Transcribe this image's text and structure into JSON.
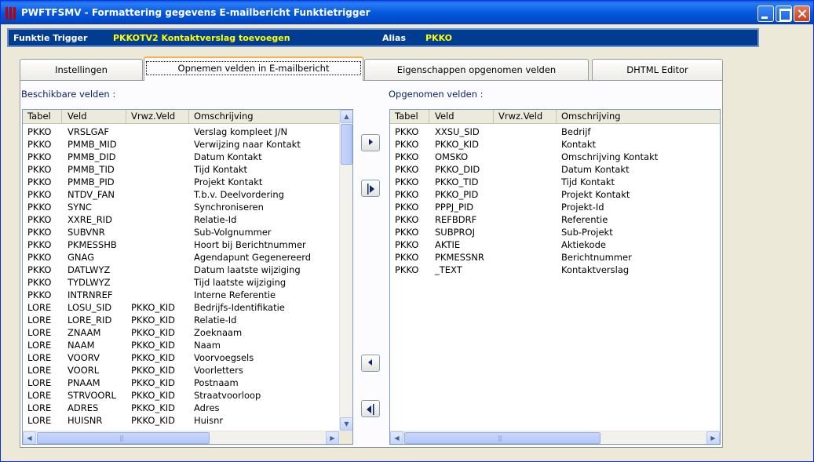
{
  "window": {
    "title": "PWFTFSMV - Formattering gegevens E-mailbericht Funktietrigger"
  },
  "infobar": {
    "function_label": "Funktie Trigger",
    "function_value": "PKKOTV2  Kontaktverslag toevoegen",
    "alias_label": "Alias",
    "alias_value": "PKKO"
  },
  "tabs": [
    {
      "label": "Instellingen"
    },
    {
      "label": "Opnemen velden in E-mailbericht"
    },
    {
      "label": "Eigenschappen opgenomen velden"
    },
    {
      "label": "DHTML Editor"
    }
  ],
  "available": {
    "title": "Beschikbare velden :",
    "columns": [
      "Tabel",
      "Veld",
      "Vrwz.Veld",
      "Omschrijving"
    ],
    "rows": [
      [
        "PKKO",
        "VRSLGAF",
        "",
        "Verslag kompleet J/N"
      ],
      [
        "PKKO",
        "PMMB_MID",
        "",
        "Verwijzing naar Kontakt"
      ],
      [
        "PKKO",
        "PMMB_DID",
        "",
        "Datum Kontakt"
      ],
      [
        "PKKO",
        "PMMB_TID",
        "",
        "Tijd Kontakt"
      ],
      [
        "PKKO",
        "PMMB_PID",
        "",
        "Projekt Kontakt"
      ],
      [
        "PKKO",
        "NTDV_FAN",
        "",
        "T.b.v. Deelvordering"
      ],
      [
        "PKKO",
        "SYNC",
        "",
        "Synchroniseren"
      ],
      [
        "PKKO",
        "XXRE_RID",
        "",
        "Relatie-Id"
      ],
      [
        "PKKO",
        "SUBVNR",
        "",
        "Sub-Volgnummer"
      ],
      [
        "PKKO",
        "PKMESSHB",
        "",
        "Hoort bij Berichtnummer"
      ],
      [
        "PKKO",
        "GNAG",
        "",
        "Agendapunt Gegenereerd"
      ],
      [
        "PKKO",
        "DATLWYZ",
        "",
        "Datum laatste wijziging"
      ],
      [
        "PKKO",
        "TYDLWYZ",
        "",
        "Tijd laatste wijziging"
      ],
      [
        "PKKO",
        "INTRNREF",
        "",
        "Interne Referentie"
      ],
      [
        "LORE",
        "LOSU_SID",
        "PKKO_KID",
        "Bedrijfs-Identifikatie"
      ],
      [
        "LORE",
        "LORE_RID",
        "PKKO_KID",
        "Relatie-Id"
      ],
      [
        "LORE",
        "ZNAAM",
        "PKKO_KID",
        "Zoeknaam"
      ],
      [
        "LORE",
        "NAAM",
        "PKKO_KID",
        "Naam"
      ],
      [
        "LORE",
        "VOORV",
        "PKKO_KID",
        "Voorvoegsels"
      ],
      [
        "LORE",
        "VOORL",
        "PKKO_KID",
        "Voorletters"
      ],
      [
        "LORE",
        "PNAAM",
        "PKKO_KID",
        "Postnaam"
      ],
      [
        "LORE",
        "STRVOORL",
        "PKKO_KID",
        "Straatvoorloop"
      ],
      [
        "LORE",
        "ADRES",
        "PKKO_KID",
        "Adres"
      ],
      [
        "LORE",
        "HUISNR",
        "PKKO_KID",
        "Huisnr"
      ]
    ]
  },
  "selected": {
    "title": "Opgenomen velden :",
    "columns": [
      "Tabel",
      "Veld",
      "Vrwz.Veld",
      "Omschrijving"
    ],
    "rows": [
      [
        "PKKO",
        "XXSU_SID",
        "",
        "Bedrijf"
      ],
      [
        "PKKO",
        "PKKO_KID",
        "",
        "Kontakt"
      ],
      [
        "PKKO",
        "OMSKO",
        "",
        "Omschrijving Kontakt"
      ],
      [
        "PKKO",
        "PKKO_DID",
        "",
        "Datum Kontakt"
      ],
      [
        "PKKO",
        "PKKO_TID",
        "",
        "Tijd Kontakt"
      ],
      [
        "PKKO",
        "PKKO_PID",
        "",
        "Projekt Kontakt"
      ],
      [
        "PKKO",
        "PPPJ_PID",
        "",
        "Projekt-Id"
      ],
      [
        "PKKO",
        "REFBDRF",
        "",
        "Referentie"
      ],
      [
        "PKKO",
        "SUBPROJ",
        "",
        "Sub-Projekt"
      ],
      [
        "PKKO",
        "AKTIE",
        "",
        "Aktiekode"
      ],
      [
        "PKKO",
        "PKMESSNR",
        "",
        "Berichtnummer"
      ],
      [
        "PKKO",
        "_TEXT",
        "",
        "Kontaktverslag"
      ]
    ]
  },
  "icons": {
    "move_right": "triangle-right-icon",
    "move_all_right": "double-triangle-right-icon",
    "move_left": "triangle-left-icon",
    "move_all_left": "double-triangle-left-icon"
  }
}
